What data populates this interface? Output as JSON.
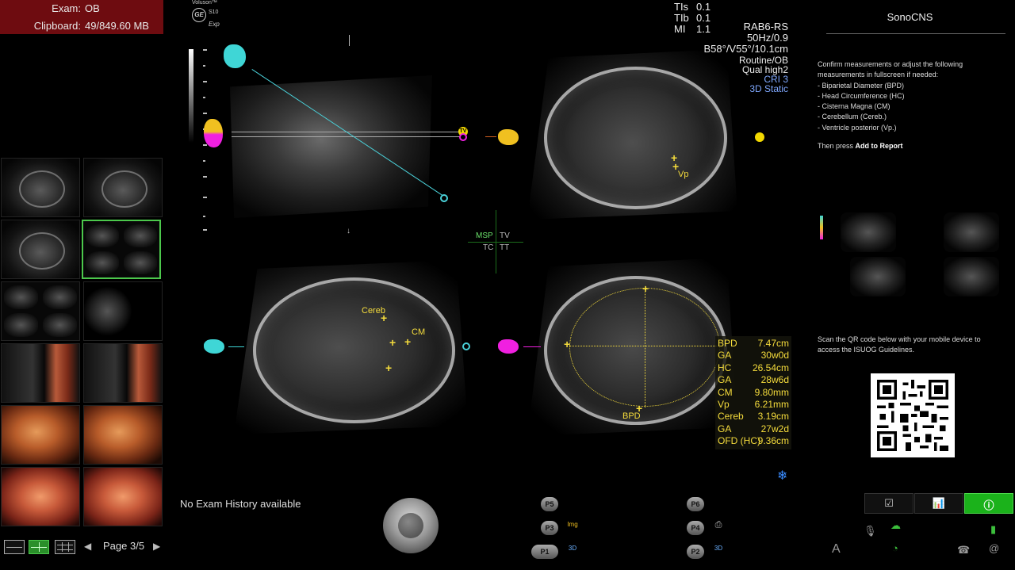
{
  "exam": {
    "exam_label": "Exam:",
    "exam_value": "OB",
    "clipboard_label": "Clipboard:",
    "clipboard_value": "49/849.60 MB"
  },
  "brand": {
    "name": "Voluson™",
    "logo": "GE",
    "model": "S10",
    "exp": "Exp"
  },
  "tis": [
    {
      "label": "TIs",
      "value": "0.1"
    },
    {
      "label": "TIb",
      "value": "0.1"
    },
    {
      "label": "MI",
      "value": "1.1"
    }
  ],
  "params": {
    "probe": "RAB6-RS",
    "freq": "50Hz/0.9",
    "angle": "B58°/V55°/10.1cm",
    "preset": "Routine/OB",
    "quality": "Qual high2",
    "cri": "CRI 3",
    "mode": "3D Static"
  },
  "planes": {
    "msp": "MSP",
    "tv": "TV",
    "tc": "TC",
    "tt": "TT"
  },
  "markers": {
    "tv": "TV",
    "tc": "TC"
  },
  "calipers": {
    "vp": "Vp",
    "cereb": "Cereb",
    "cm": "CM",
    "bpd": "BPD"
  },
  "measurements": [
    {
      "name": "BPD",
      "value": "7.47cm"
    },
    {
      "name": "GA",
      "value": "30w0d"
    },
    {
      "name": "HC",
      "value": "26.54cm"
    },
    {
      "name": "GA",
      "value": "28w6d"
    },
    {
      "name": "CM",
      "value": "9.80mm"
    },
    {
      "name": "Vp",
      "value": "6.21mm"
    },
    {
      "name": "Cereb",
      "value": "3.19cm"
    },
    {
      "name": "GA",
      "value": "27w2d"
    },
    {
      "name": "OFD (HC)",
      "value": "9.36cm"
    }
  ],
  "bottom": {
    "no_history": "No Exam History available",
    "page": "Page 3/5",
    "buttons": {
      "p5": "P5",
      "p3": "P3",
      "p1": "P1",
      "p6": "P6",
      "p4": "P4",
      "p2": "P2",
      "img": "Img",
      "three_d": "3D"
    }
  },
  "sonocns": {
    "title": "SonoCNS",
    "instructions": [
      "Confirm measurements or adjust the following",
      "measurements in fullscreen if needed:",
      "- Biparietal Diameter (BPD)",
      "- Head Circumference (HC)",
      "- Cisterna Magna (CM)",
      "- Cerebellum (Cereb.)",
      "- Ventricle posterior (Vp.)"
    ],
    "press_prefix": "Then press ",
    "press_action": "Add to Report",
    "qr_text_1": "Scan the QR code below with your mobile device to",
    "qr_text_2": "access the ISUOG Guidelines."
  },
  "tabs": {
    "edit_icon": "edit-icon",
    "chart_icon": "chart-icon",
    "info_icon": "info-icon"
  },
  "colors": {
    "caliper": "#f5dc3c",
    "accent_green": "#1bb21b",
    "exam_bar": "#6e0c10",
    "plane_cyan": "#4ad0d8",
    "params_blue": "#7fa8ff"
  }
}
